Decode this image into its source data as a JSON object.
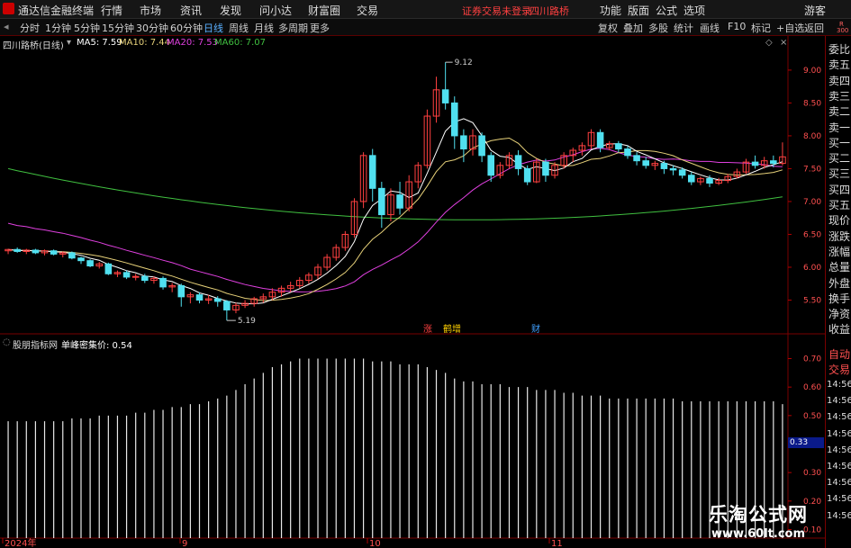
{
  "menu": {
    "app_title": "通达信金融终端",
    "items": [
      "行情",
      "市场",
      "资讯",
      "发现",
      "问小达",
      "财富圈",
      "交易"
    ],
    "status": "证券交易未登录",
    "stock_name": "四川路桥",
    "right_items": [
      "功能",
      "版面",
      "公式",
      "选项"
    ],
    "guest": "游客"
  },
  "toolbar": {
    "periods": [
      "分时",
      "1分钟",
      "5分钟",
      "15分钟",
      "30分钟",
      "60分钟",
      "日线",
      "周线",
      "月线",
      "多周期",
      "更多"
    ],
    "active": "日线",
    "right_buttons": [
      "复权",
      "叠加",
      "多股",
      "统计",
      "画线",
      "F10",
      "标记",
      "+自选",
      "返回"
    ]
  },
  "main_legend": {
    "title": "四川路桥(日线)",
    "ma": [
      {
        "label": "MA5: 7.59",
        "color": "#ffffff"
      },
      {
        "label": "MA10: 7.44",
        "color": "#e8d27a"
      },
      {
        "label": "MA20: 7.53",
        "color": "#e040e0"
      },
      {
        "label": "MA60: 7.07",
        "color": "#40c040"
      }
    ]
  },
  "price_axis": [
    "9.00",
    "8.50",
    "8.00",
    "7.50",
    "7.00",
    "6.50",
    "6.00",
    "5.50"
  ],
  "chart_annotations": {
    "high": "9.12",
    "low": "5.19"
  },
  "event_labels": [
    {
      "text": "涨",
      "color": "#ff4040"
    },
    {
      "text": "鹤增",
      "color": "#ffd000"
    },
    {
      "text": "财",
      "color": "#40a0ff"
    }
  ],
  "indicator_legend": {
    "title": "股朋指标网",
    "name": "单峰密集价: 0.54"
  },
  "indicator_axis": [
    "0.70",
    "0.60",
    "0.50",
    "0.40",
    "0.30",
    "0.20",
    "0.10"
  ],
  "indicator_current": "0.33",
  "date_axis": [
    "2024年",
    "9",
    "10",
    "11"
  ],
  "right_panel": {
    "top_labels": [
      "R",
      "300"
    ],
    "items": [
      "委比",
      "卖五",
      "卖四",
      "卖三",
      "卖二",
      "卖一",
      "买一",
      "买二",
      "买三",
      "买四",
      "买五",
      "现价",
      "涨跌",
      "涨幅",
      "总量",
      "外盘",
      "换手",
      "净资",
      "收益"
    ],
    "lower_items": [
      "自动",
      "交易"
    ],
    "times": [
      "14:56",
      "14:56",
      "14:56",
      "14:56",
      "14:56",
      "14:56",
      "14:56",
      "14:56",
      "14:56"
    ]
  },
  "watermark": {
    "title": "乐淘公式网",
    "url": "www.60lt.com"
  },
  "chart_data": {
    "type": "candlestick",
    "title": "四川路桥(日线)",
    "ylim": [
      5.0,
      9.3
    ],
    "candles": [
      [
        6.25,
        6.27,
        6.28,
        6.2
      ],
      [
        6.27,
        6.24,
        6.3,
        6.22
      ],
      [
        6.24,
        6.26,
        6.28,
        6.2
      ],
      [
        6.26,
        6.22,
        6.28,
        6.2
      ],
      [
        6.22,
        6.25,
        6.27,
        6.18
      ],
      [
        6.25,
        6.2,
        6.27,
        6.18
      ],
      [
        6.2,
        6.22,
        6.24,
        6.15
      ],
      [
        6.22,
        6.14,
        6.24,
        6.12
      ],
      [
        6.14,
        6.1,
        6.16,
        6.05
      ],
      [
        6.1,
        6.02,
        6.12,
        6.0
      ],
      [
        6.02,
        6.05,
        6.08,
        5.98
      ],
      [
        6.05,
        5.9,
        6.07,
        5.88
      ],
      [
        5.9,
        5.92,
        5.95,
        5.85
      ],
      [
        5.92,
        5.85,
        5.95,
        5.82
      ],
      [
        5.85,
        5.86,
        5.9,
        5.8
      ],
      [
        5.86,
        5.8,
        5.9,
        5.76
      ],
      [
        5.8,
        5.83,
        5.86,
        5.75
      ],
      [
        5.83,
        5.7,
        5.86,
        5.66
      ],
      [
        5.7,
        5.72,
        5.76,
        5.62
      ],
      [
        5.72,
        5.55,
        5.75,
        5.4
      ],
      [
        5.55,
        5.58,
        5.62,
        5.45
      ],
      [
        5.58,
        5.5,
        5.62,
        5.45
      ],
      [
        5.5,
        5.52,
        5.58,
        5.44
      ],
      [
        5.52,
        5.48,
        5.56,
        5.4
      ],
      [
        5.48,
        5.35,
        5.5,
        5.19
      ],
      [
        5.35,
        5.42,
        5.46,
        5.3
      ],
      [
        5.42,
        5.45,
        5.5,
        5.38
      ],
      [
        5.45,
        5.52,
        5.55,
        5.4
      ],
      [
        5.52,
        5.55,
        5.6,
        5.46
      ],
      [
        5.55,
        5.62,
        5.68,
        5.5
      ],
      [
        5.62,
        5.68,
        5.72,
        5.55
      ],
      [
        5.68,
        5.72,
        5.78,
        5.62
      ],
      [
        5.72,
        5.8,
        5.85,
        5.68
      ],
      [
        5.8,
        5.88,
        5.92,
        5.75
      ],
      [
        5.88,
        6.0,
        6.05,
        5.82
      ],
      [
        6.0,
        6.15,
        6.2,
        5.95
      ],
      [
        6.15,
        6.3,
        6.35,
        6.1
      ],
      [
        6.3,
        6.5,
        6.55,
        6.25
      ],
      [
        6.5,
        7.0,
        7.05,
        6.45
      ],
      [
        7.0,
        7.7,
        7.75,
        6.9
      ],
      [
        7.7,
        7.2,
        7.8,
        7.0
      ],
      [
        7.2,
        6.8,
        7.3,
        6.6
      ],
      [
        6.8,
        7.1,
        7.2,
        6.7
      ],
      [
        7.1,
        6.9,
        7.3,
        6.8
      ],
      [
        6.9,
        7.3,
        7.4,
        6.85
      ],
      [
        7.3,
        7.55,
        7.6,
        7.2
      ],
      [
        7.55,
        8.3,
        8.4,
        7.5
      ],
      [
        8.3,
        8.7,
        8.9,
        8.2
      ],
      [
        8.7,
        8.5,
        9.12,
        8.4
      ],
      [
        8.5,
        8.0,
        8.6,
        7.8
      ],
      [
        8.0,
        7.8,
        8.1,
        7.6
      ],
      [
        7.8,
        8.0,
        8.1,
        7.7
      ],
      [
        8.0,
        7.7,
        8.05,
        7.6
      ],
      [
        7.7,
        7.4,
        7.75,
        7.3
      ],
      [
        7.4,
        7.55,
        7.6,
        7.35
      ],
      [
        7.55,
        7.7,
        7.75,
        7.5
      ],
      [
        7.7,
        7.5,
        7.78,
        7.4
      ],
      [
        7.5,
        7.3,
        7.55,
        7.25
      ],
      [
        7.3,
        7.6,
        7.65,
        7.28
      ],
      [
        7.6,
        7.4,
        7.65,
        7.3
      ],
      [
        7.4,
        7.55,
        7.6,
        7.35
      ],
      [
        7.55,
        7.7,
        7.75,
        7.5
      ],
      [
        7.7,
        7.78,
        7.82,
        7.6
      ],
      [
        7.78,
        7.85,
        7.9,
        7.7
      ],
      [
        7.85,
        8.05,
        8.1,
        7.8
      ],
      [
        8.05,
        7.82,
        8.1,
        7.75
      ],
      [
        7.82,
        7.88,
        7.92,
        7.78
      ],
      [
        7.88,
        7.8,
        7.92,
        7.75
      ],
      [
        7.8,
        7.7,
        7.85,
        7.65
      ],
      [
        7.7,
        7.62,
        7.75,
        7.55
      ],
      [
        7.62,
        7.55,
        7.68,
        7.5
      ],
      [
        7.55,
        7.58,
        7.62,
        7.48
      ],
      [
        7.58,
        7.5,
        7.62,
        7.42
      ],
      [
        7.5,
        7.48,
        7.55,
        7.4
      ],
      [
        7.48,
        7.4,
        7.52,
        7.35
      ],
      [
        7.4,
        7.3,
        7.45,
        7.25
      ],
      [
        7.3,
        7.35,
        7.38,
        7.25
      ],
      [
        7.35,
        7.28,
        7.4,
        7.22
      ],
      [
        7.28,
        7.32,
        7.36,
        7.25
      ],
      [
        7.32,
        7.38,
        7.42,
        7.28
      ],
      [
        7.38,
        7.45,
        7.5,
        7.35
      ],
      [
        7.45,
        7.6,
        7.65,
        7.42
      ],
      [
        7.6,
        7.55,
        7.7,
        7.5
      ],
      [
        7.55,
        7.62,
        7.68,
        7.5
      ],
      [
        7.62,
        7.58,
        7.7,
        7.52
      ],
      [
        7.58,
        7.68,
        7.9,
        7.55
      ]
    ],
    "ma60_endpoints": [
      7.5,
      6.55,
      7.07
    ],
    "indicator_values": [
      0.48,
      0.48,
      0.48,
      0.48,
      0.48,
      0.48,
      0.48,
      0.49,
      0.49,
      0.49,
      0.5,
      0.5,
      0.5,
      0.5,
      0.51,
      0.51,
      0.52,
      0.52,
      0.53,
      0.53,
      0.54,
      0.54,
      0.55,
      0.56,
      0.57,
      0.59,
      0.61,
      0.63,
      0.65,
      0.67,
      0.68,
      0.69,
      0.7,
      0.7,
      0.7,
      0.7,
      0.7,
      0.7,
      0.7,
      0.7,
      0.69,
      0.69,
      0.69,
      0.68,
      0.68,
      0.68,
      0.67,
      0.66,
      0.65,
      0.63,
      0.62,
      0.62,
      0.61,
      0.61,
      0.61,
      0.6,
      0.6,
      0.6,
      0.59,
      0.59,
      0.59,
      0.58,
      0.58,
      0.57,
      0.57,
      0.57,
      0.56,
      0.56,
      0.56,
      0.56,
      0.56,
      0.56,
      0.56,
      0.56,
      0.55,
      0.55,
      0.55,
      0.55,
      0.55,
      0.55,
      0.55,
      0.55,
      0.55,
      0.55,
      0.55,
      0.54
    ]
  }
}
